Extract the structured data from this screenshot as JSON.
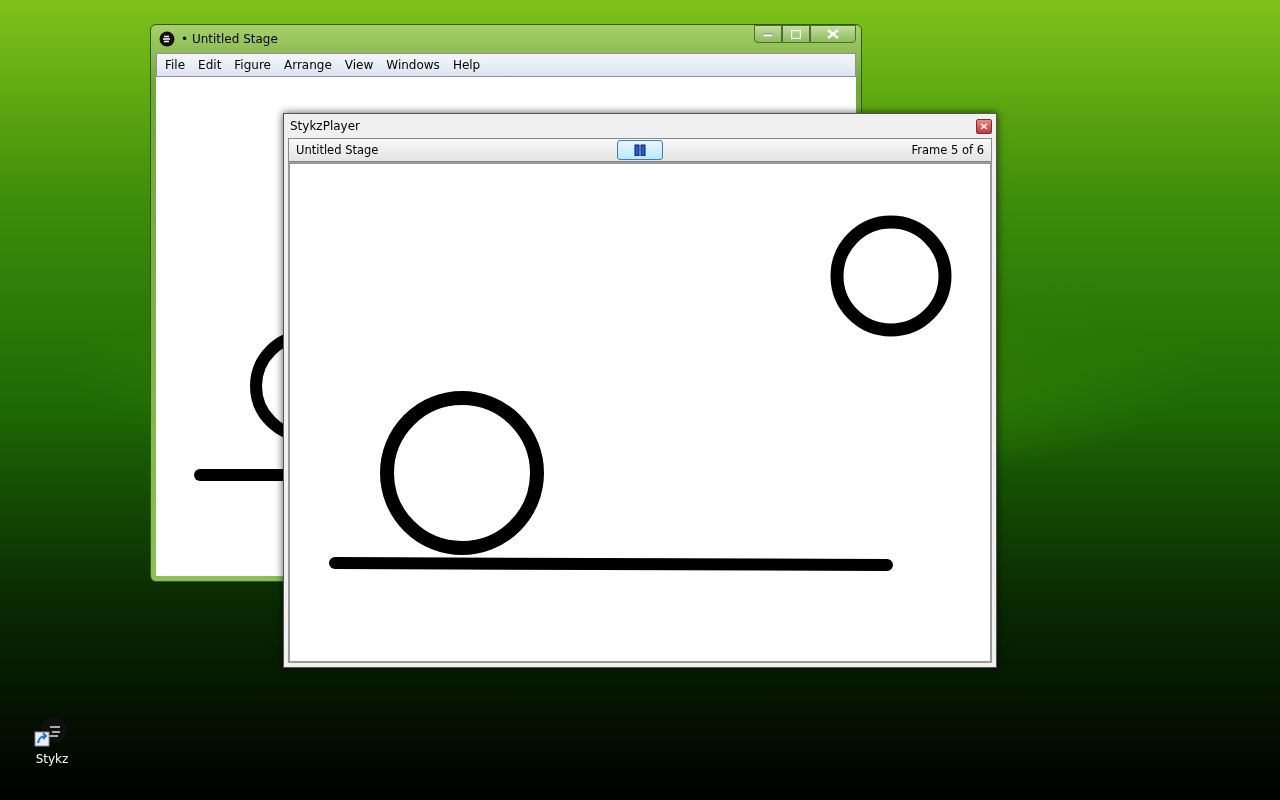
{
  "editor_window": {
    "title": "• Untitled Stage",
    "menu": [
      "File",
      "Edit",
      "Figure",
      "Arrange",
      "View",
      "Windows",
      "Help"
    ]
  },
  "player_window": {
    "title": "StykzPlayer",
    "stage_name": "Untitled Stage",
    "frame_counter": "Frame 5 of 6"
  },
  "desktop_icons": [
    {
      "label": "Stykz"
    }
  ]
}
